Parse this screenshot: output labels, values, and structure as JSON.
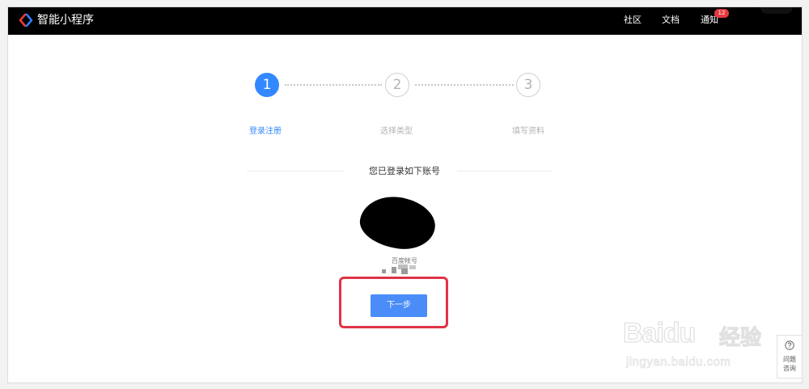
{
  "header": {
    "app_title": "智能小程序",
    "nav": [
      {
        "label": "社区"
      },
      {
        "label": "文档"
      },
      {
        "label": "通知"
      }
    ],
    "notification_count": "12"
  },
  "steps": [
    {
      "number": "1",
      "label": "登录注册",
      "active": true
    },
    {
      "number": "2",
      "label": "选择类型",
      "active": false
    },
    {
      "number": "3",
      "label": "填写资料",
      "active": false
    }
  ],
  "main": {
    "logged_in_title": "您已登录如下账号",
    "account_label": "百度帐号",
    "next_button": "下一步"
  },
  "help": {
    "line1": "问题",
    "line2": "咨询"
  },
  "watermark": {
    "brand": "Baidu",
    "brand_cn": "经验",
    "url": "jingyan.baidu.com"
  },
  "colors": {
    "accent": "#3388ff",
    "button": "#4a8df8",
    "highlight": "#e03346",
    "badge": "#e6393e"
  }
}
